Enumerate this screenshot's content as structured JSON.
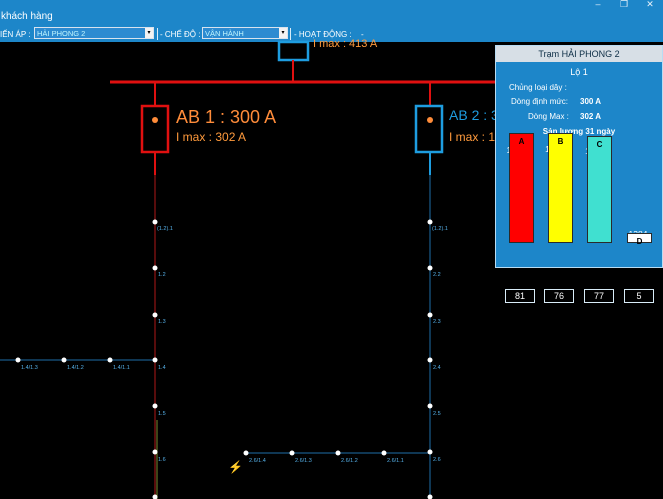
{
  "app": {
    "title": "khách hàng",
    "win_buttons": [
      "–",
      "❐",
      "✕"
    ]
  },
  "toolbar": {
    "voltage_label": "IẾN ÁP :",
    "voltage_value": "HẢI PHONG 2",
    "mode_label": "- CHẾ ĐỘ :",
    "mode_value": "VẬN HÀNH",
    "activity_label": "- HOẠT ĐỘNG :",
    "activity_value": "-"
  },
  "diagram": {
    "top_imax": "I max : 413 A",
    "breakers": [
      {
        "name": "AB 1 : 300 A",
        "imax": "I max : 302 A"
      },
      {
        "name": "AB 2 : 3",
        "imax": "I max : 1"
      }
    ],
    "left_nodes": [
      "(1.2).1",
      "1.2",
      "1.3",
      "1.4",
      "1.5",
      "1.6"
    ],
    "right_nodes": [
      "(1.2).1",
      "2.2",
      "2.3",
      "2.4",
      "2.5",
      "2.6"
    ],
    "branch_left": [
      "1.4/1.3",
      "1.4/1.2",
      "1.4/1.1"
    ],
    "branch_right": [
      "2.6/1.4",
      "2.6/1.3",
      "2.6/1.2",
      "2.6/1.1"
    ]
  },
  "panel": {
    "title": "Trạm HẢI PHONG 2",
    "feeder": "Lộ 1",
    "wire_label": "Chủng loại dây :",
    "rated_label": "Dòng định mức:",
    "rated_value": "300 A",
    "max_label": "Dòng Max :",
    "max_value": "302 A",
    "output_title": "Sản lượng 31 ngày",
    "phases": [
      {
        "name": "A",
        "value": "15112",
        "count": "81",
        "color": "#ff0000",
        "fill": 0.74
      },
      {
        "name": "B",
        "value": "15226",
        "count": "76",
        "color": "#ffff00",
        "fill": 0.74
      },
      {
        "name": "C",
        "value": "14783",
        "count": "77",
        "color": "#40e0d0",
        "fill": 0.72
      },
      {
        "name": "D",
        "value": "1384",
        "count": "5",
        "color": "#ffffff",
        "fill": 0.07
      }
    ]
  }
}
